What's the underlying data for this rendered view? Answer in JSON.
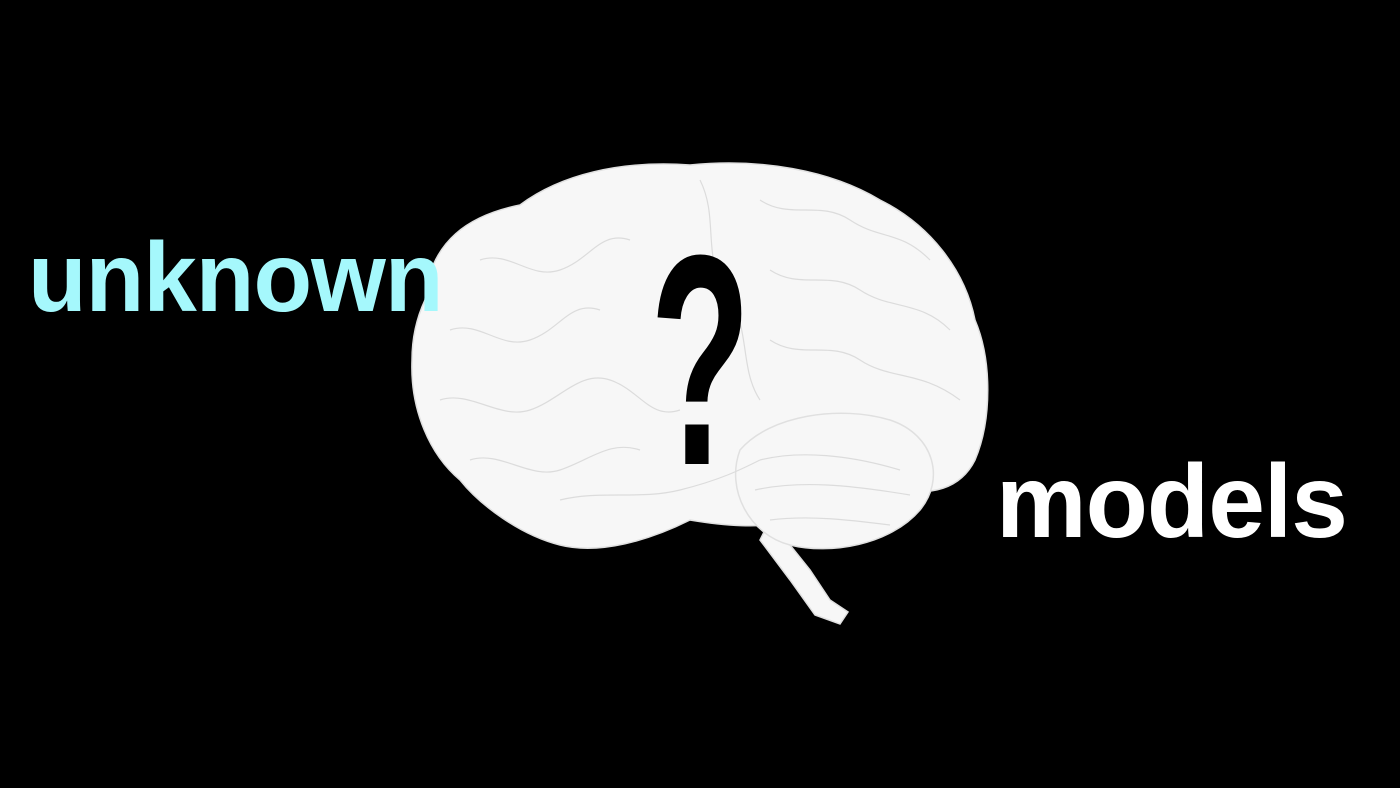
{
  "words": {
    "left": "unknown",
    "right": "models"
  },
  "center_symbol": "?",
  "colors": {
    "background": "#000000",
    "left_word": "#a5f8fc",
    "right_word": "#ffffff",
    "brain": "#f7f7f7",
    "brain_lines": "#d8d8d8"
  }
}
